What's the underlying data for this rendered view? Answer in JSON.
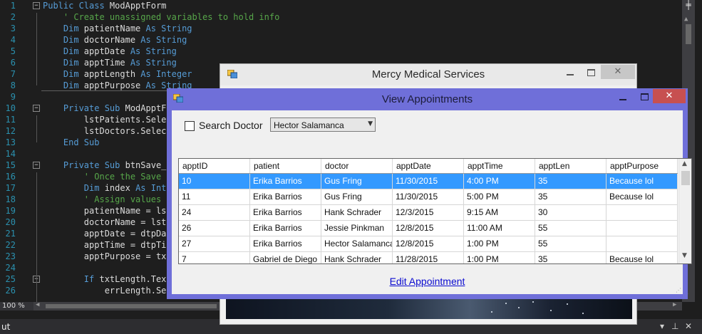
{
  "editor": {
    "lines": [
      {
        "n": "1",
        "fold": "−",
        "tokens": [
          [
            "kw",
            "Public Class "
          ],
          [
            "",
            "ModApptForm"
          ]
        ]
      },
      {
        "n": "2",
        "tokens": [
          [
            "cm",
            "    ' Create unassigned variables to hold info"
          ]
        ]
      },
      {
        "n": "3",
        "tokens": [
          [
            "kw",
            "    Dim "
          ],
          [
            "",
            "patientName "
          ],
          [
            "kw",
            "As String"
          ]
        ]
      },
      {
        "n": "4",
        "tokens": [
          [
            "kw",
            "    Dim "
          ],
          [
            "",
            "doctorName "
          ],
          [
            "kw",
            "As String"
          ]
        ]
      },
      {
        "n": "5",
        "tokens": [
          [
            "kw",
            "    Dim "
          ],
          [
            "",
            "apptDate "
          ],
          [
            "kw",
            "As String"
          ]
        ]
      },
      {
        "n": "6",
        "tokens": [
          [
            "kw",
            "    Dim "
          ],
          [
            "",
            "apptTime "
          ],
          [
            "kw",
            "As String"
          ]
        ]
      },
      {
        "n": "7",
        "tokens": [
          [
            "kw",
            "    Dim "
          ],
          [
            "",
            "apptLength "
          ],
          [
            "kw",
            "As Integer"
          ]
        ]
      },
      {
        "n": "8",
        "tokens": [
          [
            "kw",
            "    Dim "
          ],
          [
            "",
            "apptPurpose "
          ],
          [
            "kw",
            "As String"
          ]
        ]
      },
      {
        "n": "9",
        "tokens": []
      },
      {
        "n": "10",
        "fold": "−",
        "tokens": [
          [
            "kw",
            "    Private Sub "
          ],
          [
            "",
            "ModApptFo"
          ]
        ]
      },
      {
        "n": "11",
        "tokens": [
          [
            "",
            "        lstPatients.Selec"
          ]
        ]
      },
      {
        "n": "12",
        "tokens": [
          [
            "",
            "        lstDoctors.Select"
          ]
        ]
      },
      {
        "n": "13",
        "tokens": [
          [
            "kw",
            "    End Sub"
          ]
        ]
      },
      {
        "n": "14",
        "tokens": []
      },
      {
        "n": "15",
        "fold": "−",
        "tokens": [
          [
            "kw",
            "    Private Sub "
          ],
          [
            "",
            "btnSave_C"
          ]
        ]
      },
      {
        "n": "16",
        "tokens": [
          [
            "cm",
            "        ' Once the Save b"
          ]
        ]
      },
      {
        "n": "17",
        "tokens": [
          [
            "kw",
            "        Dim "
          ],
          [
            "",
            "index "
          ],
          [
            "kw",
            "As Inte"
          ]
        ]
      },
      {
        "n": "18",
        "tokens": [
          [
            "cm",
            "        ' Assign values t"
          ]
        ]
      },
      {
        "n": "19",
        "tokens": [
          [
            "",
            "        patientName = lst"
          ]
        ]
      },
      {
        "n": "20",
        "tokens": [
          [
            "",
            "        doctorName = lstD"
          ]
        ]
      },
      {
        "n": "21",
        "tokens": [
          [
            "",
            "        apptDate = dtpDat"
          ]
        ]
      },
      {
        "n": "22",
        "tokens": [
          [
            "",
            "        apptTime = dtpTim"
          ]
        ]
      },
      {
        "n": "23",
        "tokens": [
          [
            "",
            "        apptPurpose = txt"
          ]
        ]
      },
      {
        "n": "24",
        "tokens": []
      },
      {
        "n": "25",
        "fold": "−",
        "tokens": [
          [
            "kw",
            "        If "
          ],
          [
            "",
            "txtLength.Text"
          ]
        ]
      },
      {
        "n": "26",
        "tokens": [
          [
            "",
            "            errLength.Set"
          ]
        ]
      }
    ],
    "zoom": "100 %",
    "bottom_panel_title": "ut"
  },
  "back_form": {
    "title": "Mercy Medical Services",
    "close_glyph": "✕"
  },
  "view_form": {
    "title": "View Appointments",
    "close_glyph": "✕",
    "search_doctor_label": "Search Doctor",
    "search_doctor_checked": false,
    "doctor_selected": "Hector Salamanca",
    "columns": [
      "apptID",
      "patient",
      "doctor",
      "apptDate",
      "apptTime",
      "apptLen",
      "apptPurpose"
    ],
    "rows": [
      [
        "10",
        "Erika Barrios",
        "Gus Fring",
        "11/30/2015",
        "4:00 PM",
        "35",
        "Because lol"
      ],
      [
        "11",
        "Erika Barrios",
        "Gus Fring",
        "11/30/2015",
        "5:00 PM",
        "35",
        "Because lol"
      ],
      [
        "24",
        "Erika Barrios",
        "Hank Schrader",
        "12/3/2015",
        "9:15 AM",
        "30",
        ""
      ],
      [
        "26",
        "Erika Barrios",
        "Jessie Pinkman",
        "12/8/2015",
        "11:00 AM",
        "55",
        ""
      ],
      [
        "27",
        "Erika Barrios",
        "Hector Salamanca",
        "12/8/2015",
        "1:00 PM",
        "55",
        ""
      ],
      [
        "7",
        "Gabriel de Diego",
        "Hank Schrader",
        "11/28/2015",
        "1:00 PM",
        "35",
        "Because lol"
      ]
    ],
    "selected_row_index": 0,
    "edit_link": "Edit Appointment",
    "colors": {
      "titlebar": "#6f6fd9",
      "selection": "#3399ff",
      "close": "#c75050",
      "link": "#0a0ad0"
    }
  }
}
